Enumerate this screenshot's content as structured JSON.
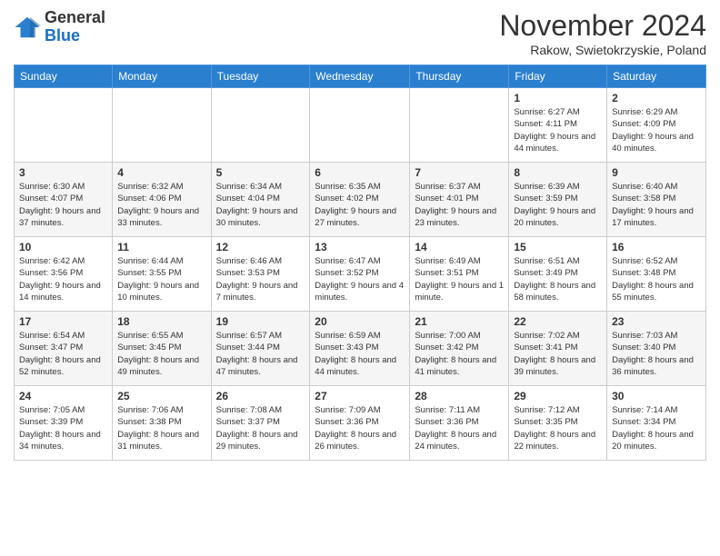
{
  "header": {
    "logo_general": "General",
    "logo_blue": "Blue",
    "month_title": "November 2024",
    "subtitle": "Rakow, Swietokrzyskie, Poland"
  },
  "days_of_week": [
    "Sunday",
    "Monday",
    "Tuesday",
    "Wednesday",
    "Thursday",
    "Friday",
    "Saturday"
  ],
  "weeks": [
    [
      {
        "day": "",
        "info": ""
      },
      {
        "day": "",
        "info": ""
      },
      {
        "day": "",
        "info": ""
      },
      {
        "day": "",
        "info": ""
      },
      {
        "day": "",
        "info": ""
      },
      {
        "day": "1",
        "info": "Sunrise: 6:27 AM\nSunset: 4:11 PM\nDaylight: 9 hours and 44 minutes."
      },
      {
        "day": "2",
        "info": "Sunrise: 6:29 AM\nSunset: 4:09 PM\nDaylight: 9 hours and 40 minutes."
      }
    ],
    [
      {
        "day": "3",
        "info": "Sunrise: 6:30 AM\nSunset: 4:07 PM\nDaylight: 9 hours and 37 minutes."
      },
      {
        "day": "4",
        "info": "Sunrise: 6:32 AM\nSunset: 4:06 PM\nDaylight: 9 hours and 33 minutes."
      },
      {
        "day": "5",
        "info": "Sunrise: 6:34 AM\nSunset: 4:04 PM\nDaylight: 9 hours and 30 minutes."
      },
      {
        "day": "6",
        "info": "Sunrise: 6:35 AM\nSunset: 4:02 PM\nDaylight: 9 hours and 27 minutes."
      },
      {
        "day": "7",
        "info": "Sunrise: 6:37 AM\nSunset: 4:01 PM\nDaylight: 9 hours and 23 minutes."
      },
      {
        "day": "8",
        "info": "Sunrise: 6:39 AM\nSunset: 3:59 PM\nDaylight: 9 hours and 20 minutes."
      },
      {
        "day": "9",
        "info": "Sunrise: 6:40 AM\nSunset: 3:58 PM\nDaylight: 9 hours and 17 minutes."
      }
    ],
    [
      {
        "day": "10",
        "info": "Sunrise: 6:42 AM\nSunset: 3:56 PM\nDaylight: 9 hours and 14 minutes."
      },
      {
        "day": "11",
        "info": "Sunrise: 6:44 AM\nSunset: 3:55 PM\nDaylight: 9 hours and 10 minutes."
      },
      {
        "day": "12",
        "info": "Sunrise: 6:46 AM\nSunset: 3:53 PM\nDaylight: 9 hours and 7 minutes."
      },
      {
        "day": "13",
        "info": "Sunrise: 6:47 AM\nSunset: 3:52 PM\nDaylight: 9 hours and 4 minutes."
      },
      {
        "day": "14",
        "info": "Sunrise: 6:49 AM\nSunset: 3:51 PM\nDaylight: 9 hours and 1 minute."
      },
      {
        "day": "15",
        "info": "Sunrise: 6:51 AM\nSunset: 3:49 PM\nDaylight: 8 hours and 58 minutes."
      },
      {
        "day": "16",
        "info": "Sunrise: 6:52 AM\nSunset: 3:48 PM\nDaylight: 8 hours and 55 minutes."
      }
    ],
    [
      {
        "day": "17",
        "info": "Sunrise: 6:54 AM\nSunset: 3:47 PM\nDaylight: 8 hours and 52 minutes."
      },
      {
        "day": "18",
        "info": "Sunrise: 6:55 AM\nSunset: 3:45 PM\nDaylight: 8 hours and 49 minutes."
      },
      {
        "day": "19",
        "info": "Sunrise: 6:57 AM\nSunset: 3:44 PM\nDaylight: 8 hours and 47 minutes."
      },
      {
        "day": "20",
        "info": "Sunrise: 6:59 AM\nSunset: 3:43 PM\nDaylight: 8 hours and 44 minutes."
      },
      {
        "day": "21",
        "info": "Sunrise: 7:00 AM\nSunset: 3:42 PM\nDaylight: 8 hours and 41 minutes."
      },
      {
        "day": "22",
        "info": "Sunrise: 7:02 AM\nSunset: 3:41 PM\nDaylight: 8 hours and 39 minutes."
      },
      {
        "day": "23",
        "info": "Sunrise: 7:03 AM\nSunset: 3:40 PM\nDaylight: 8 hours and 36 minutes."
      }
    ],
    [
      {
        "day": "24",
        "info": "Sunrise: 7:05 AM\nSunset: 3:39 PM\nDaylight: 8 hours and 34 minutes."
      },
      {
        "day": "25",
        "info": "Sunrise: 7:06 AM\nSunset: 3:38 PM\nDaylight: 8 hours and 31 minutes."
      },
      {
        "day": "26",
        "info": "Sunrise: 7:08 AM\nSunset: 3:37 PM\nDaylight: 8 hours and 29 minutes."
      },
      {
        "day": "27",
        "info": "Sunrise: 7:09 AM\nSunset: 3:36 PM\nDaylight: 8 hours and 26 minutes."
      },
      {
        "day": "28",
        "info": "Sunrise: 7:11 AM\nSunset: 3:36 PM\nDaylight: 8 hours and 24 minutes."
      },
      {
        "day": "29",
        "info": "Sunrise: 7:12 AM\nSunset: 3:35 PM\nDaylight: 8 hours and 22 minutes."
      },
      {
        "day": "30",
        "info": "Sunrise: 7:14 AM\nSunset: 3:34 PM\nDaylight: 8 hours and 20 minutes."
      }
    ]
  ]
}
